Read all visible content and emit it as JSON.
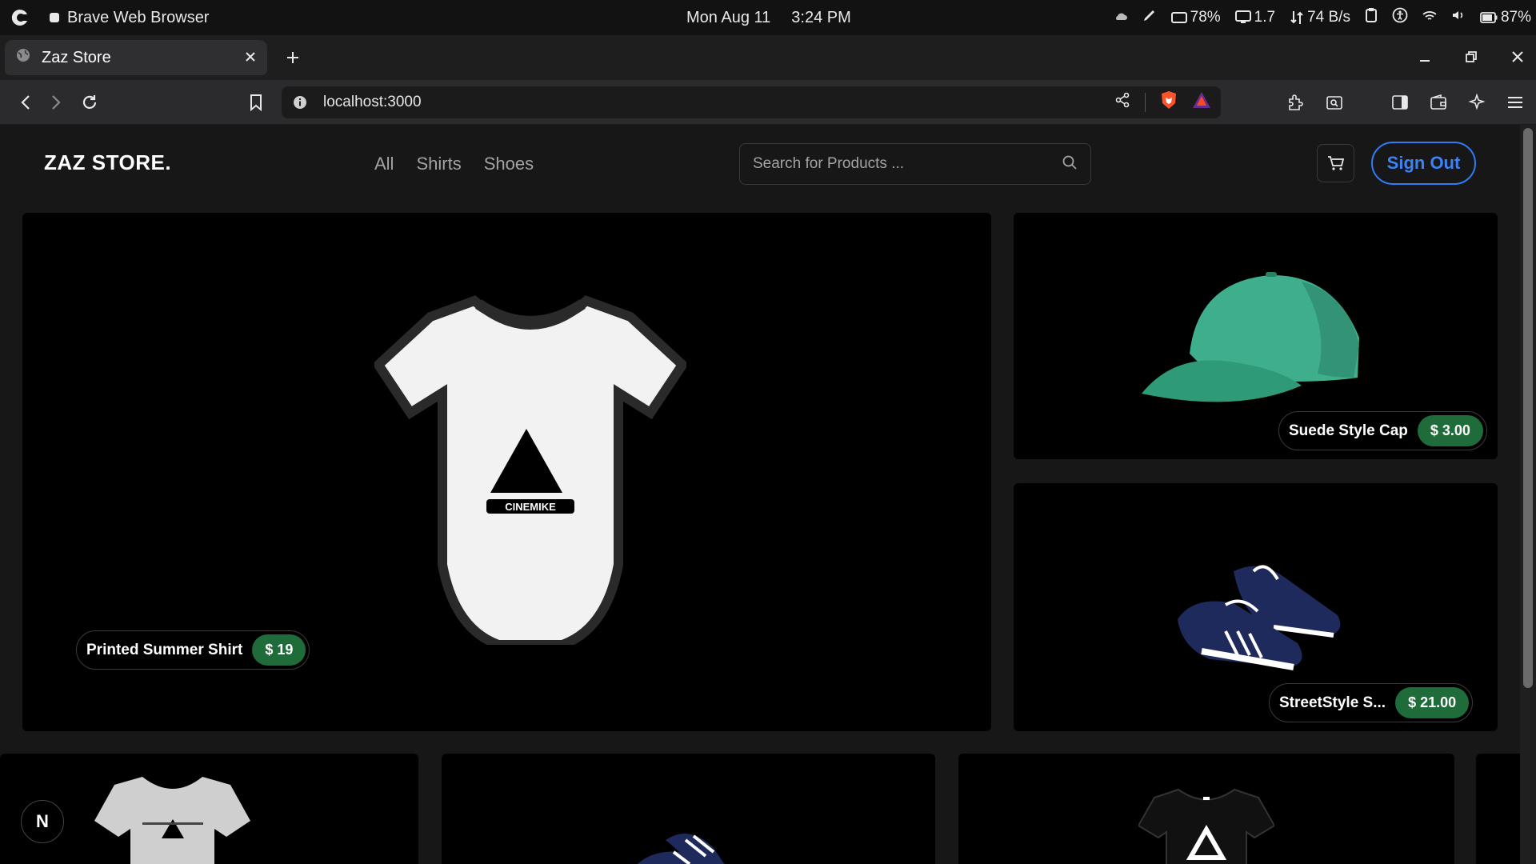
{
  "os": {
    "app_name": "Brave Web Browser",
    "date": "Mon Aug 11",
    "time": "3:24 PM",
    "battery_device": "78%",
    "cpu_load": "1.7",
    "net_speed": "74 B/s",
    "battery_main": "87%"
  },
  "browser": {
    "tab_title": "Zaz Store",
    "url": "localhost:3000"
  },
  "site": {
    "logo": "ZAZ STORE.",
    "nav": [
      "All",
      "Shirts",
      "Shoes"
    ],
    "search_placeholder": "Search for Products ...",
    "sign_out": "Sign Out",
    "dev_badge": "N"
  },
  "products": {
    "hero": {
      "name": "Printed Summer Shirt",
      "price": "$ 19"
    },
    "cap": {
      "name": "Suede Style Cap",
      "price": "$ 3.00"
    },
    "shoes": {
      "name": "StreetStyle S...",
      "price": "$ 21.00"
    }
  },
  "colors": {
    "accent": "#2f7cf6",
    "price_bg": "#1f6b3a",
    "cap_green": "#3fae8c",
    "shoe_navy": "#1f2a5c"
  }
}
